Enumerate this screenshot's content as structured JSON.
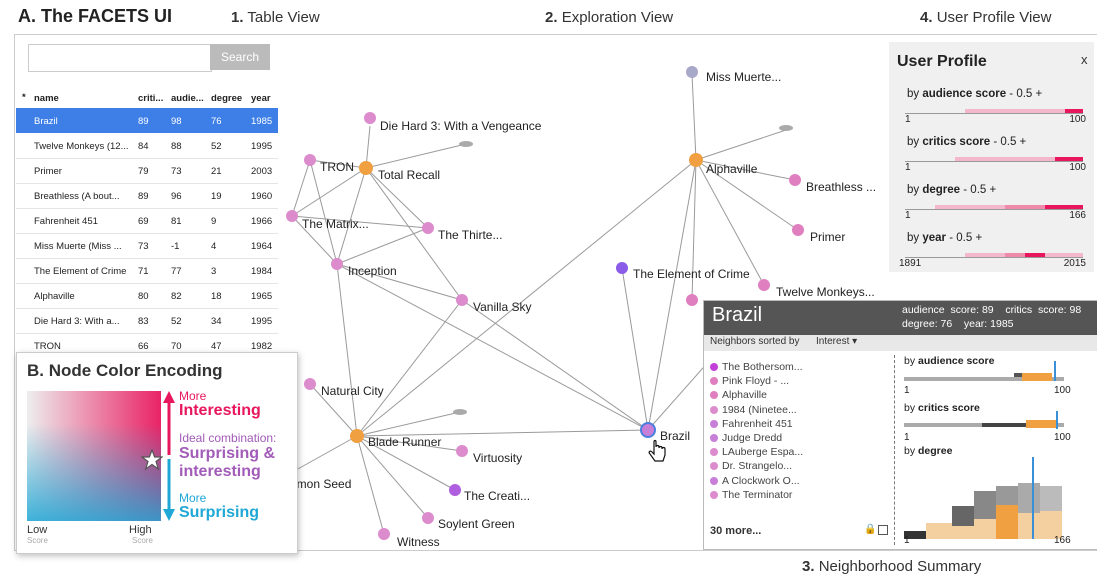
{
  "headings": {
    "a_label": "A. The FACETS UI",
    "v1_num": "1.",
    "v1_text": "Table View",
    "v2_num": "2.",
    "v2_text": "Exploration View",
    "v4_num": "4.",
    "v4_text": "User Profile View",
    "v3_num": "3.",
    "v3_text": "Neighborhood Summary"
  },
  "table": {
    "search_placeholder": "",
    "search_label": "Search",
    "sort_marker": "*",
    "columns": [
      "name",
      "criti...",
      "audie...",
      "degree",
      "year"
    ],
    "rows": [
      [
        "Brazil",
        "89",
        "98",
        "76",
        "1985"
      ],
      [
        "Twelve Monkeys (12...",
        "84",
        "88",
        "52",
        "1995"
      ],
      [
        "Primer",
        "79",
        "73",
        "21",
        "2003"
      ],
      [
        "Breathless (A bout...",
        "89",
        "96",
        "19",
        "1960"
      ],
      [
        "Fahrenheit 451",
        "69",
        "81",
        "9",
        "1966"
      ],
      [
        "Miss Muerte (Miss ...",
        "73",
        "-1",
        "4",
        "1964"
      ],
      [
        "The Element of Crime",
        "71",
        "77",
        "3",
        "1984"
      ],
      [
        "Alphaville",
        "80",
        "82",
        "18",
        "1965"
      ],
      [
        "Die Hard 3: With a...",
        "83",
        "52",
        "34",
        "1995"
      ],
      [
        "TRON",
        "66",
        "70",
        "47",
        "1982"
      ]
    ]
  },
  "graph_labels": {
    "miss_muerte": "Miss Muerte...",
    "diehard": "Die Hard 3: With a Vengeance",
    "tron": "TRON",
    "total_recall": "Total Recall",
    "alphaville": "Alphaville",
    "breathless": "Breathless ...",
    "matrix": "The Matrix...",
    "thirteenth": "The Thirte...",
    "primer": "Primer",
    "inception": "Inception",
    "element": "The Element of Crime",
    "twelve": "Twelve Monkeys...",
    "vanilla": "Vanilla Sky",
    "natural": "Natural City",
    "blade": "Blade Runner",
    "virtuosity": "Virtuosity",
    "lemon": "emon Seed",
    "creati": "The Creati...",
    "soylent": "Soylent Green",
    "witness": "Witness",
    "brazil": "Brazil"
  },
  "legend": {
    "title": "B. Node Color Encoding",
    "more1": "More",
    "interesting": "Interesting",
    "ideal": "Ideal combination:",
    "surprising_and": "Surprising &",
    "interesting2": "interesting",
    "more2": "More",
    "surprising": "Surprising",
    "low": "Low",
    "low_sub": "Score",
    "high": "High",
    "high_sub": "Score",
    "colors": {
      "interesting": "#e8175d",
      "surprising": "#1fa8d6",
      "ideal": "#a25bb8"
    }
  },
  "profile": {
    "title": "User Profile",
    "close": "x",
    "by": "by",
    "delta": "- 0.5 +",
    "rows": [
      {
        "attr": "audience score",
        "min": "1",
        "max": "100"
      },
      {
        "attr": "critics score",
        "min": "1",
        "max": "100"
      },
      {
        "attr": "degree",
        "min": "1",
        "max": "166"
      },
      {
        "attr": "year",
        "min": "1891",
        "max": "2015"
      }
    ]
  },
  "summary": {
    "title": "Brazil",
    "stats1": "audience  score: 89    critics  score: 98",
    "stats2": "degree: 76    year: 1985",
    "sorted_by": "Neighbors sorted by",
    "sort_value": "Interest",
    "neighbors": [
      "The Bothersom...",
      "Pink Floyd - ...",
      "Alphaville",
      "1984 (Ninetee...",
      "Fahrenheit 451",
      "Judge Dredd",
      "LAuberge Espa...",
      "Dr. Strangelo...",
      "A Clockwork O...",
      "The Terminator"
    ],
    "more": "30 more...",
    "hist": [
      {
        "by": "by",
        "attr": "audience score",
        "min": "1",
        "max": "100"
      },
      {
        "by": "by",
        "attr": "critics score",
        "min": "1",
        "max": "100"
      },
      {
        "by": "by",
        "attr": "degree",
        "min": "1",
        "max": "166"
      }
    ]
  }
}
